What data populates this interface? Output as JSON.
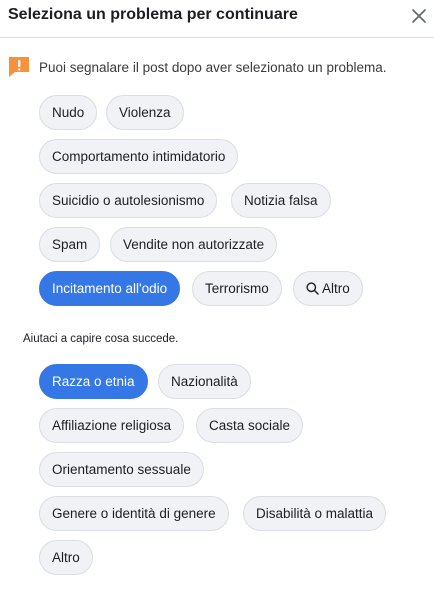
{
  "dialog": {
    "title": "Seleziona un problema per continuare",
    "close_icon": "close-icon"
  },
  "notice": {
    "icon": "exclamation-flag-icon",
    "icon_color": "#f7923b",
    "text": "Puoi segnalare il post dopo aver selezionato un problema."
  },
  "problems": [
    {
      "label": "Nudo",
      "selected": false
    },
    {
      "label": "Violenza",
      "selected": false
    },
    {
      "label": "Comportamento intimidatorio",
      "selected": false
    },
    {
      "label": "Suicidio o autolesionismo",
      "selected": false
    },
    {
      "label": "Notizia falsa",
      "selected": false
    },
    {
      "label": "Spam",
      "selected": false
    },
    {
      "label": "Vendite non autorizzate",
      "selected": false
    },
    {
      "label": "Incitamento all'odio",
      "selected": true
    },
    {
      "label": "Terrorismo",
      "selected": false
    },
    {
      "label": "Altro",
      "selected": false,
      "icon": "search-icon"
    }
  ],
  "helper_text": "Aiutaci a capire cosa succede.",
  "subcategories": [
    {
      "label": "Razza o etnia",
      "selected": true
    },
    {
      "label": "Nazionalità",
      "selected": false
    },
    {
      "label": "Affiliazione religiosa",
      "selected": false
    },
    {
      "label": "Casta sociale",
      "selected": false
    },
    {
      "label": "Orientamento sessuale",
      "selected": false
    },
    {
      "label": "Genere o identità di genere",
      "selected": false
    },
    {
      "label": "Disabilità o malattia",
      "selected": false
    },
    {
      "label": "Altro",
      "selected": false
    }
  ],
  "colors": {
    "accent": "#3578e5",
    "chip_background": "#f0f2f5",
    "chip_border": "#dadde1"
  }
}
